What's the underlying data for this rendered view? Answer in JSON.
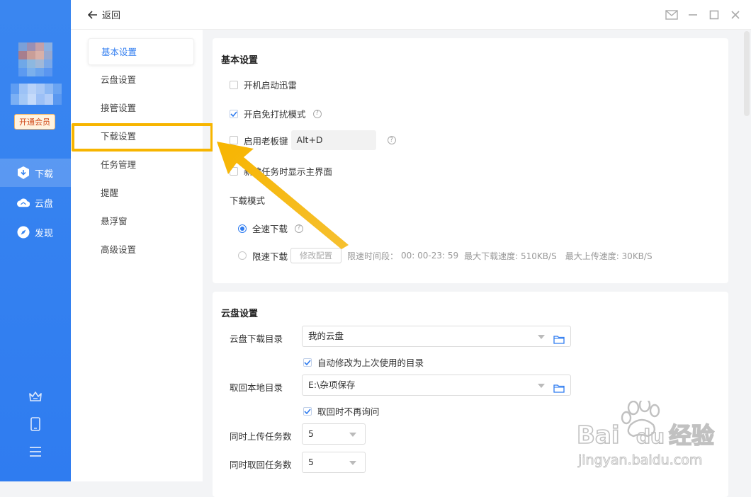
{
  "sidebar": {
    "vip_label": "开通会员",
    "items": [
      {
        "label": "下载",
        "icon": "download-icon"
      },
      {
        "label": "云盘",
        "icon": "cloud-icon"
      },
      {
        "label": "发现",
        "icon": "compass-icon"
      }
    ],
    "bottom_icons": [
      "crown-icon",
      "phone-icon",
      "menu-icon"
    ]
  },
  "topbar": {
    "back_label": "返回",
    "controls": [
      "mail-icon",
      "minimize-icon",
      "maximize-icon",
      "close-icon"
    ]
  },
  "settings_nav": {
    "items": [
      "基本设置",
      "云盘设置",
      "接管设置",
      "下载设置",
      "任务管理",
      "提醒",
      "悬浮窗",
      "高级设置"
    ],
    "active_index": 0,
    "highlighted_index": 3
  },
  "basic": {
    "title": "基本设置",
    "startup": {
      "label": "开机启动迅雷",
      "checked": false
    },
    "dnd": {
      "label": "开启免打扰模式",
      "checked": true
    },
    "boss_key": {
      "label": "启用老板键",
      "checked": false,
      "value": "Alt+D"
    },
    "show_main": {
      "label": "新建任务时显示主界面",
      "checked": false
    },
    "download_mode": {
      "title": "下载模式",
      "full_speed": "全速下载",
      "limited": "限速下载",
      "modify_btn": "修改配置",
      "limit_time_label": "限速时间段：",
      "limit_time_value": "00: 00-23: 59",
      "max_down_label": "最大下载速度: 510KB/S",
      "max_up_label": "最大上传速度: 30KB/S",
      "selected": "full_speed"
    }
  },
  "cloud": {
    "title": "云盘设置",
    "download_dir_label": "云盘下载目录",
    "download_dir_value": "我的云盘",
    "auto_modify_label": "自动修改为上次使用的目录",
    "retrieve_dir_label": "取回本地目录",
    "retrieve_dir_value": "E:\\杂项保存",
    "no_ask_label": "取回时不再询问",
    "upload_tasks_label": "同时上传任务数",
    "upload_tasks_value": "5",
    "retrieve_tasks_label": "同时取回任务数",
    "retrieve_tasks_value": "5"
  },
  "watermark": {
    "brand": "Baidu经验",
    "url": "jingyan.baidu.com"
  },
  "colors": {
    "accent": "#2f7cf0",
    "highlight": "#f7b500",
    "sidebar": "#3a86f0",
    "vip_text": "#d14a1b"
  }
}
